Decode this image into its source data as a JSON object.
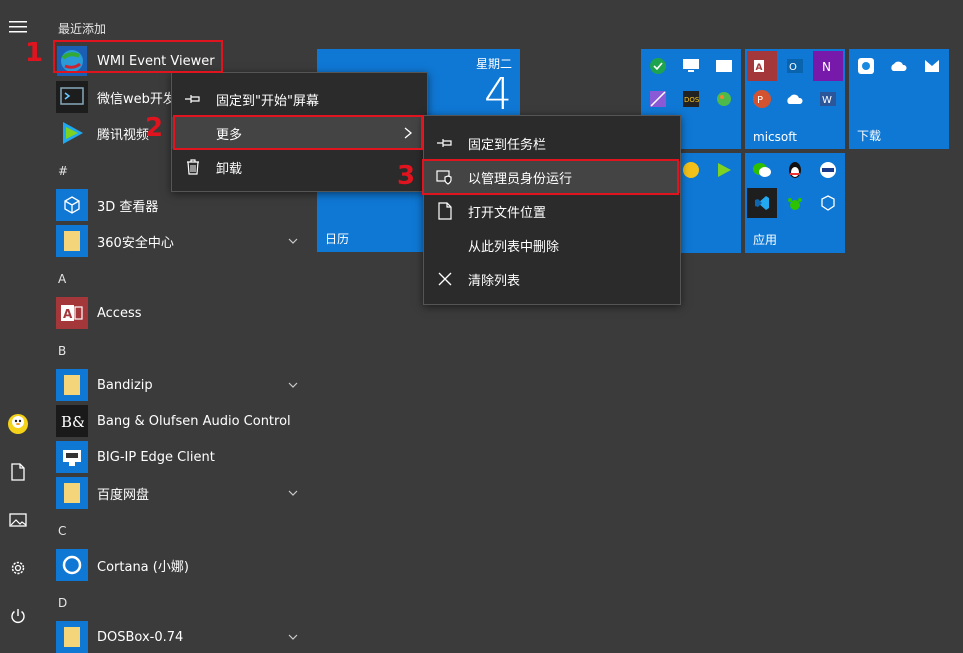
{
  "recent_header": "最近添加",
  "recent": [
    {
      "label": "WMI Event Viewer"
    },
    {
      "label": "微信web开发"
    },
    {
      "label": "腾讯视频"
    }
  ],
  "groups": [
    {
      "letter": "#",
      "items": [
        {
          "label": "3D 查看器"
        },
        {
          "label": "360安全中心"
        }
      ]
    },
    {
      "letter": "A",
      "items": [
        {
          "label": "Access"
        }
      ]
    },
    {
      "letter": "B",
      "items": [
        {
          "label": "Bandizip"
        },
        {
          "label": "Bang & Olufsen Audio Control"
        },
        {
          "label": "BIG-IP Edge Client"
        },
        {
          "label": "百度网盘"
        }
      ]
    },
    {
      "letter": "C",
      "items": [
        {
          "label": "Cortana (小娜)"
        }
      ]
    },
    {
      "letter": "D",
      "items": [
        {
          "label": "DOSBox-0.74"
        }
      ]
    }
  ],
  "calendar": {
    "weekday": "星期二",
    "day": "4",
    "label": "日历"
  },
  "tiles": {
    "micsoft": "micsoft",
    "download": "下载",
    "apps": "应用"
  },
  "context_menu": {
    "pin_start": "固定到\"开始\"屏幕",
    "more": "更多",
    "uninstall": "卸载"
  },
  "submenu": {
    "pin_taskbar": "固定到任务栏",
    "run_admin": "以管理员身份运行",
    "open_location": "打开文件位置",
    "remove_list": "从此列表中删除",
    "clear_list": "清除列表"
  },
  "steps": {
    "s1": "1",
    "s2": "2",
    "s3": "3"
  },
  "colors": {
    "tile_blue": "#0f78d4",
    "highlight_red": "#e0141e",
    "menu_bg": "#2b2b2b"
  }
}
